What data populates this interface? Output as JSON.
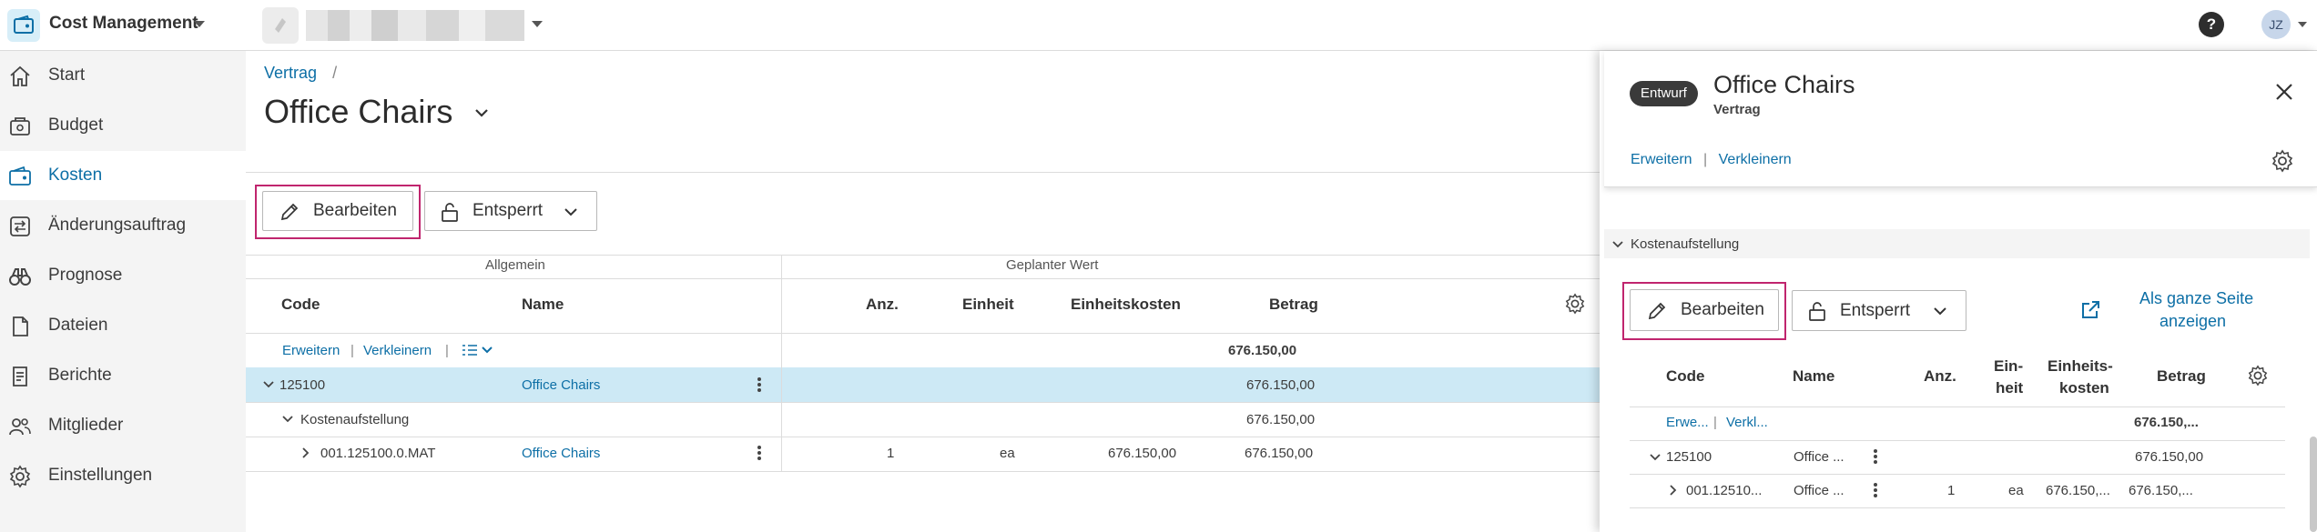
{
  "app": {
    "name": "Cost Management",
    "user_initials": "JZ",
    "help_label": "?"
  },
  "sidebar": {
    "items": [
      {
        "label": "Start",
        "icon": "home-icon"
      },
      {
        "label": "Budget",
        "icon": "budget-icon"
      },
      {
        "label": "Kosten",
        "icon": "cost-icon",
        "active": true
      },
      {
        "label": "Änderungsauftrag",
        "icon": "change-order-icon"
      },
      {
        "label": "Prognose",
        "icon": "binoculars-icon"
      },
      {
        "label": "Dateien",
        "icon": "file-icon"
      },
      {
        "label": "Berichte",
        "icon": "report-icon"
      },
      {
        "label": "Mitglieder",
        "icon": "members-icon"
      },
      {
        "label": "Einstellungen",
        "icon": "gear-icon"
      }
    ]
  },
  "main": {
    "breadcrumb": {
      "parent": "Vertrag",
      "separator": "/"
    },
    "title": "Office Chairs",
    "toolbar": {
      "edit_label": "Bearbeiten",
      "lock_label": "Entsperrt"
    },
    "groups": {
      "general": "Allgemein",
      "planned": "Geplanter Wert"
    },
    "columns": {
      "code": "Code",
      "name": "Name",
      "qty": "Anz.",
      "unit": "Einheit",
      "unit_cost": "Einheitskosten",
      "amount": "Betrag"
    },
    "controls": {
      "expand": "Erweitern",
      "collapse": "Verkleinern",
      "sep": "|",
      "total": "676.150,00"
    },
    "rows": [
      {
        "code": "125100",
        "name": "Office Chairs",
        "amount": "676.150,00"
      },
      {
        "code": "Kostenaufstellung",
        "amount": "676.150,00"
      },
      {
        "code": "001.125100.0.MAT",
        "name": "Office Chairs",
        "qty": "1",
        "unit": "ea",
        "unit_cost": "676.150,00",
        "amount": "676.150,00"
      }
    ]
  },
  "panel": {
    "badge": "Entwurf",
    "title": "Office Chairs",
    "subtitle": "Vertrag",
    "expand": "Erweitern",
    "collapse": "Verkleinern",
    "sep": "|",
    "section": "Kostenaufstellung",
    "edit_label": "Bearbeiten",
    "lock_label": "Entsperrt",
    "full_page_line1": "Als ganze Seite",
    "full_page_line2": "anzeigen",
    "columns": {
      "code": "Code",
      "name": "Name",
      "qty": "Anz.",
      "unit_l1": "Ein-",
      "unit_l2": "heit",
      "uc_l1": "Einheits-",
      "uc_l2": "kosten",
      "amount": "Betrag"
    },
    "controls": {
      "expand": "Erwe...",
      "collapse": "Verkl...",
      "sep": "|",
      "total": "676.150,..."
    },
    "rows": [
      {
        "code": "125100",
        "name": "Office ...",
        "amount": "676.150,00"
      },
      {
        "code": "001.12510...",
        "name": "Office ...",
        "qty": "1",
        "unit": "ea",
        "unit_cost": "676.150,...",
        "amount": "676.150,..."
      }
    ]
  },
  "colors": {
    "accent": "#0d6fa6",
    "highlight": "#c0256e",
    "selected_row": "#cde9f5",
    "sidebar_bg": "#f4f4f4"
  }
}
